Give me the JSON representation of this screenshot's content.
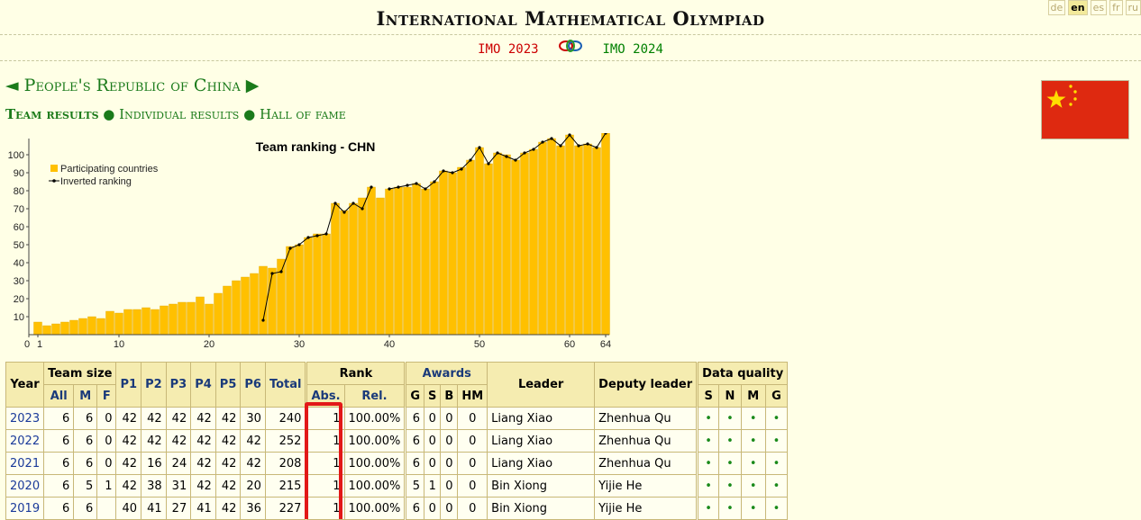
{
  "header": {
    "site_title": "International Mathematical Olympiad",
    "languages": [
      "de",
      "en",
      "es",
      "fr",
      "ru"
    ],
    "active_language": "en",
    "prev_imo": "IMO 2023",
    "next_imo": "IMO 2024"
  },
  "country": {
    "prev_arrow": "◄",
    "name": "People's Republic of China",
    "next_arrow": "▶"
  },
  "subnav": {
    "team_results": "Team results",
    "sep": "●",
    "individual_results": "Individual results",
    "hall_of_fame": "Hall of fame"
  },
  "chart_data": {
    "type": "bar",
    "title": "Team ranking - CHN",
    "legend": [
      "Participating countries",
      "Inverted ranking"
    ],
    "legend_position": "top-left",
    "x_ticks": [
      "0",
      "1",
      "10",
      "20",
      "30",
      "40",
      "50",
      "60",
      "64"
    ],
    "y_ticks": [
      "10",
      "20",
      "30",
      "40",
      "50",
      "60",
      "70",
      "80",
      "90",
      "100"
    ],
    "ylim": [
      0,
      112
    ],
    "xlim": [
      0,
      64
    ],
    "colors": {
      "bars": "#ffc000",
      "bar_edge": "#e0a800",
      "line": "#000000"
    },
    "x": [
      1,
      2,
      3,
      4,
      5,
      6,
      7,
      8,
      9,
      10,
      11,
      12,
      13,
      14,
      15,
      16,
      17,
      18,
      19,
      20,
      21,
      22,
      23,
      24,
      25,
      26,
      27,
      28,
      29,
      30,
      31,
      32,
      33,
      34,
      35,
      36,
      37,
      38,
      39,
      40,
      41,
      42,
      43,
      44,
      45,
      46,
      47,
      48,
      49,
      50,
      51,
      52,
      53,
      54,
      55,
      56,
      57,
      58,
      59,
      60,
      61,
      62,
      63,
      64
    ],
    "participating": [
      7,
      5,
      6,
      7,
      8,
      9,
      10,
      9,
      13,
      12,
      14,
      14,
      15,
      14,
      16,
      17,
      18,
      18,
      21,
      17,
      23,
      27,
      30,
      32,
      34,
      38,
      37,
      42,
      49,
      50,
      54,
      56,
      56,
      73,
      69,
      73,
      76,
      82,
      76,
      81,
      82,
      82,
      84,
      81,
      85,
      91,
      90,
      93,
      97,
      104,
      95,
      101,
      100,
      97,
      101,
      103,
      107,
      109,
      105,
      111,
      105,
      106,
      104,
      112
    ],
    "inverted_ranking": [
      null,
      null,
      null,
      null,
      null,
      null,
      null,
      null,
      null,
      null,
      null,
      null,
      null,
      null,
      null,
      null,
      null,
      null,
      null,
      null,
      null,
      null,
      null,
      null,
      null,
      8,
      34,
      35,
      48,
      50,
      54,
      55,
      56,
      73,
      68,
      73,
      70,
      82,
      null,
      81,
      82,
      83,
      84,
      81,
      85,
      91,
      90,
      92,
      97,
      104,
      95,
      101,
      99,
      97,
      101,
      103,
      107,
      109,
      105,
      111,
      105,
      106,
      104,
      112
    ]
  },
  "table": {
    "headers": {
      "year": "Year",
      "team_size": "Team size",
      "all": "All",
      "m": "M",
      "f": "F",
      "p1": "P1",
      "p2": "P2",
      "p3": "P3",
      "p4": "P4",
      "p5": "P5",
      "p6": "P6",
      "total": "Total",
      "rank": "Rank",
      "abs": "Abs.",
      "rel": "Rel.",
      "awards": "Awards",
      "g": "G",
      "s": "S",
      "b": "B",
      "hm": "HM",
      "leader": "Leader",
      "deputy": "Deputy leader",
      "data_quality": "Data quality",
      "dq_s": "S",
      "dq_n": "N",
      "dq_m": "M",
      "dq_g": "G"
    },
    "rows": [
      {
        "year": "2023",
        "all": "6",
        "m": "6",
        "f": "0",
        "p": [
          "42",
          "42",
          "42",
          "42",
          "42",
          "30"
        ],
        "total": "240",
        "abs": "1",
        "rel": "100.00%",
        "g": "6",
        "s": "0",
        "b": "0",
        "hm": "0",
        "leader": "Liang Xiao",
        "deputy": "Zhenhua Qu",
        "dq": [
          "•",
          "•",
          "•",
          "•"
        ]
      },
      {
        "year": "2022",
        "all": "6",
        "m": "6",
        "f": "0",
        "p": [
          "42",
          "42",
          "42",
          "42",
          "42",
          "42"
        ],
        "total": "252",
        "abs": "1",
        "rel": "100.00%",
        "g": "6",
        "s": "0",
        "b": "0",
        "hm": "0",
        "leader": "Liang Xiao",
        "deputy": "Zhenhua Qu",
        "dq": [
          "•",
          "•",
          "•",
          "•"
        ]
      },
      {
        "year": "2021",
        "all": "6",
        "m": "6",
        "f": "0",
        "p": [
          "42",
          "16",
          "24",
          "42",
          "42",
          "42"
        ],
        "total": "208",
        "abs": "1",
        "rel": "100.00%",
        "g": "6",
        "s": "0",
        "b": "0",
        "hm": "0",
        "leader": "Liang Xiao",
        "deputy": "Zhenhua Qu",
        "dq": [
          "•",
          "•",
          "•",
          "•"
        ]
      },
      {
        "year": "2020",
        "all": "6",
        "m": "5",
        "f": "1",
        "p": [
          "42",
          "38",
          "31",
          "42",
          "42",
          "20"
        ],
        "total": "215",
        "abs": "1",
        "rel": "100.00%",
        "g": "5",
        "s": "1",
        "b": "0",
        "hm": "0",
        "leader": "Bin Xiong",
        "deputy": "Yijie He",
        "dq": [
          "•",
          "•",
          "•",
          "•"
        ]
      },
      {
        "year": "2019",
        "all": "6",
        "m": "6",
        "f": "",
        "p": [
          "40",
          "41",
          "27",
          "41",
          "42",
          "36"
        ],
        "total": "227",
        "abs": "1",
        "rel": "100.00%",
        "g": "6",
        "s": "0",
        "b": "0",
        "hm": "0",
        "leader": "Bin Xiong",
        "deputy": "Yijie He",
        "dq": [
          "•",
          "•",
          "•",
          "•"
        ]
      }
    ]
  }
}
